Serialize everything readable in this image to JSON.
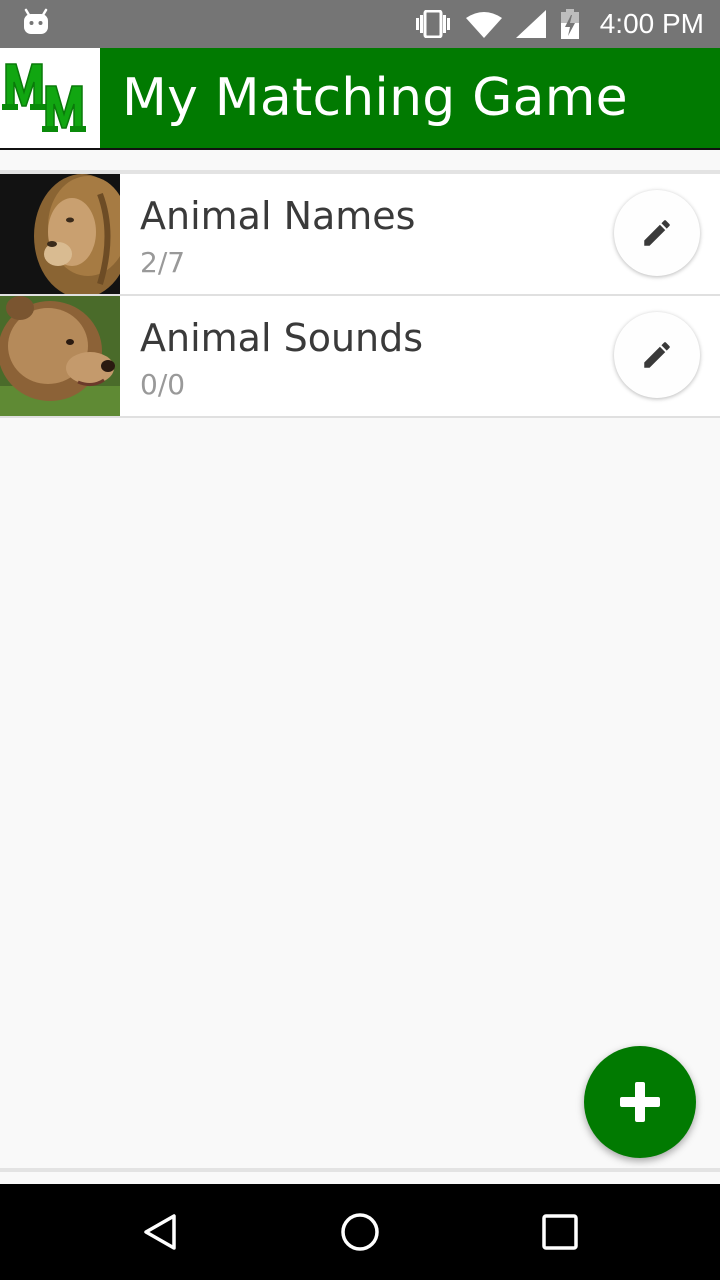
{
  "status_bar": {
    "time": "4:00 PM",
    "icons": [
      "android-debug-icon",
      "vibrate-icon",
      "wifi-icon",
      "signal-icon",
      "battery-charging-icon"
    ]
  },
  "app_bar": {
    "title": "My Matching Game",
    "logo_text": "MM",
    "brand_color": "#017a01"
  },
  "games": [
    {
      "name": "Animal Names",
      "progress": "2/7",
      "thumbnail": "lion-photo"
    },
    {
      "name": "Animal Sounds",
      "progress": "0/0",
      "thumbnail": "bear-photo"
    }
  ],
  "fab": {
    "icon": "plus-icon"
  },
  "nav_bar": {
    "buttons": [
      "back-icon",
      "home-icon",
      "recents-icon"
    ]
  }
}
